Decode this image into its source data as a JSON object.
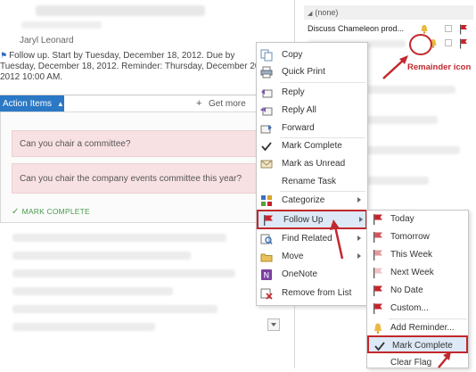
{
  "reading_pane": {
    "sender": "Jaryl Leonard",
    "followup_text": "Follow up.  Start by Tuesday, December 18, 2012.  Due by Tuesday, December 18, 2012.  Reminder: Thursday, December 20, 2012 10:00 AM.",
    "action_items_tab": "Action Items",
    "get_more": "Get more",
    "cards": [
      "Can you chair a committee?",
      "Can you chair the company events committee this year?"
    ],
    "mark_complete_link": "MARK COMPLETE"
  },
  "mail_list": {
    "group_header": "(none)",
    "row1_subject": "Discuss Chameleon prod..."
  },
  "annotation": {
    "reminder_label": "Remainder icon"
  },
  "context_menu": {
    "items": [
      {
        "label": "Copy",
        "icon": "copy-icon",
        "submenu": false
      },
      {
        "label": "Quick Print",
        "icon": "print-icon",
        "submenu": false
      },
      {
        "label": "Reply",
        "icon": "reply-icon",
        "submenu": false
      },
      {
        "label": "Reply All",
        "icon": "reply-all-icon",
        "submenu": false
      },
      {
        "label": "Forward",
        "icon": "forward-icon",
        "submenu": false
      },
      {
        "label": "Mark Complete",
        "icon": "checkmark-icon",
        "submenu": false
      },
      {
        "label": "Mark as Unread",
        "icon": "envelope-icon",
        "submenu": false
      },
      {
        "label": "Rename Task",
        "icon": "",
        "submenu": false
      },
      {
        "label": "Categorize",
        "icon": "categorize-icon",
        "submenu": true
      },
      {
        "label": "Follow Up",
        "icon": "flag-icon",
        "submenu": true,
        "highlighted": true
      },
      {
        "label": "Find Related",
        "icon": "find-related-icon",
        "submenu": true
      },
      {
        "label": "Move",
        "icon": "move-icon",
        "submenu": true
      },
      {
        "label": "OneNote",
        "icon": "onenote-icon",
        "submenu": false
      },
      {
        "label": "Remove from List",
        "icon": "remove-icon",
        "submenu": false
      }
    ]
  },
  "follow_up_submenu": {
    "items": [
      {
        "label": "Today",
        "icon": "flag-red-icon"
      },
      {
        "label": "Tomorrow",
        "icon": "flag-red-icon"
      },
      {
        "label": "This Week",
        "icon": "flag-light-icon"
      },
      {
        "label": "Next Week",
        "icon": "flag-light-icon"
      },
      {
        "label": "No Date",
        "icon": "flag-red-icon"
      },
      {
        "label": "Custom...",
        "icon": "flag-red-icon"
      },
      {
        "label": "Add Reminder...",
        "icon": "bell-icon"
      },
      {
        "label": "Mark Complete",
        "icon": "checkmark-icon",
        "highlighted": true
      },
      {
        "label": "Clear Flag",
        "icon": ""
      }
    ]
  },
  "colors": {
    "accent_blue": "#2b78c5",
    "annotation_red": "#c2282d",
    "card_pink": "#f8e1e3",
    "flag_red": "#c8232c"
  }
}
